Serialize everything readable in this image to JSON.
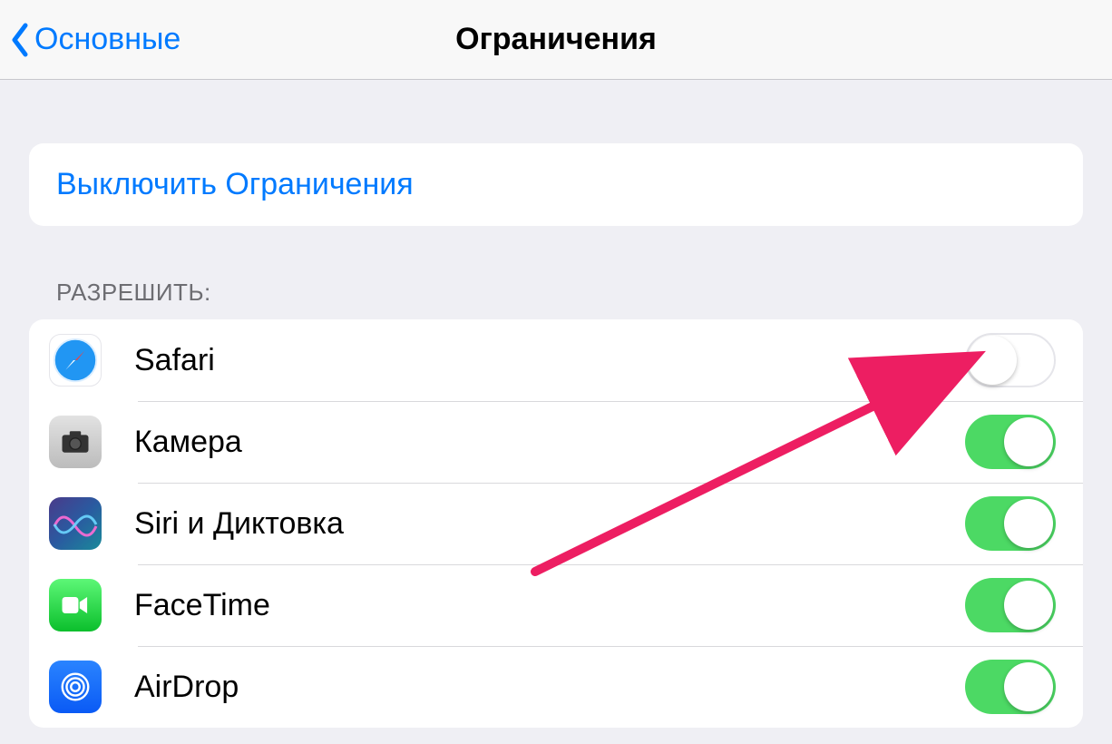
{
  "nav": {
    "back_label": "Основные",
    "title": "Ограничения"
  },
  "disable_row": {
    "label": "Выключить Ограничения"
  },
  "section_allow": {
    "header": "РАЗРЕШИТЬ:"
  },
  "items": [
    {
      "label": "Safari",
      "enabled": false,
      "icon": "safari"
    },
    {
      "label": "Камера",
      "enabled": true,
      "icon": "camera"
    },
    {
      "label": "Siri и Диктовка",
      "enabled": true,
      "icon": "siri"
    },
    {
      "label": "FaceTime",
      "enabled": true,
      "icon": "facetime"
    },
    {
      "label": "AirDrop",
      "enabled": true,
      "icon": "airdrop"
    }
  ],
  "annotation": {
    "arrow_color": "#ed1e62"
  }
}
